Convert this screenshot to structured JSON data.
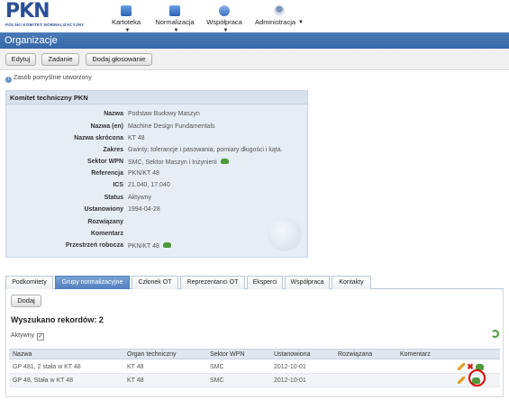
{
  "header": {
    "logo_text": "PKN",
    "logo_sub": "POLSKI KOMITET NORMALIZACYJNY",
    "nav": [
      {
        "label": "Kartoteka",
        "icon": "folder-icon"
      },
      {
        "label": "Normalizacja",
        "icon": "folder-icon"
      },
      {
        "label": "Współpraca",
        "icon": "people-icon"
      },
      {
        "label": "Administracja",
        "icon": "admin-icon"
      }
    ]
  },
  "title": "Organizacje",
  "toolbar": {
    "edit": "Edytuj",
    "task": "Zadanie",
    "add_vote": "Dodaj głosowanie"
  },
  "info_message": "Zasób pomyślnie utworzony",
  "panel": {
    "title": "Komitet techniczny PKN",
    "fields": [
      {
        "k": "Nazwa",
        "v": "Podstaw Budowy Maszyn"
      },
      {
        "k": "Nazwa (en)",
        "v": "Machine Design Fundamentals"
      },
      {
        "k": "Nazwa skrócona",
        "v": "KT 48"
      },
      {
        "k": "Zakres",
        "v": "Gwinty; tolerancje i pasowania; pomiary długości i kąta."
      },
      {
        "k": "Sektor WPN",
        "v": "SMC, Sektor Maszyn i Inżynierii"
      },
      {
        "k": "Referencja",
        "v": "PKN/KT 48"
      },
      {
        "k": "ICS",
        "v": "21.040, 17.040"
      },
      {
        "k": "Status",
        "v": "Aktywny"
      },
      {
        "k": "Ustanowiony",
        "v": "1994-04-28"
      },
      {
        "k": "Rozwiązany",
        "v": ""
      },
      {
        "k": "Komentarz",
        "v": ""
      },
      {
        "k": "Przestrzeń robocza",
        "v": "PKN/KT 48"
      }
    ]
  },
  "tabs": [
    "Podkomitety",
    "Grupy normalizacyjne",
    "Członek OT",
    "Reprezentanci OT",
    "Eksperci",
    "Współpraca",
    "Kontakty"
  ],
  "tab_panel": {
    "add_button": "Dodaj",
    "records": "Wyszukano rekordów: 2",
    "active_label": "Aktywny",
    "active_checked": "✓",
    "columns": [
      "Nazwa",
      "Organ techniczny",
      "Sektor WPN",
      "Ustanowiona",
      "Rozwiązana",
      "Komentarz"
    ],
    "rows": [
      {
        "name": "GP 481, 2  stała w KT 48",
        "organ": "KT 48",
        "sektor": "SMC",
        "ust": "2012-10-01",
        "roz": "",
        "kom": ""
      },
      {
        "name": "GP 48, Stała w KT 48",
        "organ": "KT 48",
        "sektor": "SMC",
        "ust": "2012-10-01",
        "roz": "",
        "kom": ""
      }
    ]
  },
  "colors": {
    "accent": "#3569a8",
    "panel_bg": "#e6edf5",
    "highlight": "#dd0000"
  }
}
